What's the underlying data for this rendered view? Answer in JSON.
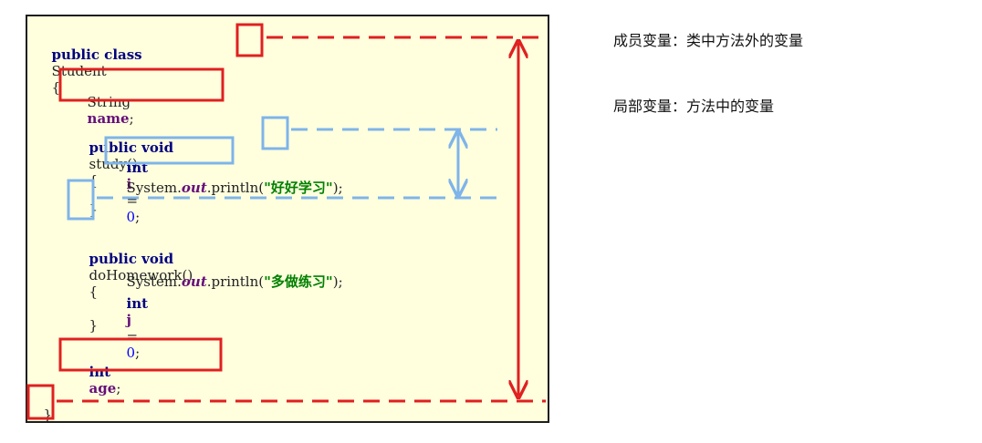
{
  "code": {
    "class_decl": {
      "kw": "public class",
      "name": "Student",
      "brace": "{"
    },
    "field_name": {
      "type": "String",
      "name": "name",
      "end": ";"
    },
    "study_decl": {
      "kw": "public void",
      "name": "study",
      "parens": "()",
      "brace": "{"
    },
    "study_local": {
      "kw": "int",
      "var": "i",
      "eq": "=",
      "val": "0",
      "end": ";"
    },
    "study_print": {
      "cls": "System.",
      "field": "out",
      "call": ".println(",
      "str": "\"好好学习\"",
      "end": ");"
    },
    "study_close": "}",
    "homework_decl": {
      "kw": "public void",
      "name": "doHomework",
      "parens": "()",
      "brace": "{"
    },
    "homework_print": {
      "cls": "System.",
      "field": "out",
      "call": ".println(",
      "str": "\"多做练习\"",
      "end": ");"
    },
    "homework_local": {
      "kw": "int",
      "var": "j",
      "eq": "=",
      "val": "0",
      "end": ";"
    },
    "homework_close": "}",
    "field_age": {
      "kw": "int",
      "name": "age",
      "end": ";"
    },
    "class_close": "}"
  },
  "notes": {
    "member_variable": "成员变量：类中方法外的变量",
    "local_variable": "局部变量：方法中的变量"
  },
  "colors": {
    "panel_bg": "#ffffde",
    "member_scope": "#e02020",
    "local_scope": "#7fb4ea"
  }
}
